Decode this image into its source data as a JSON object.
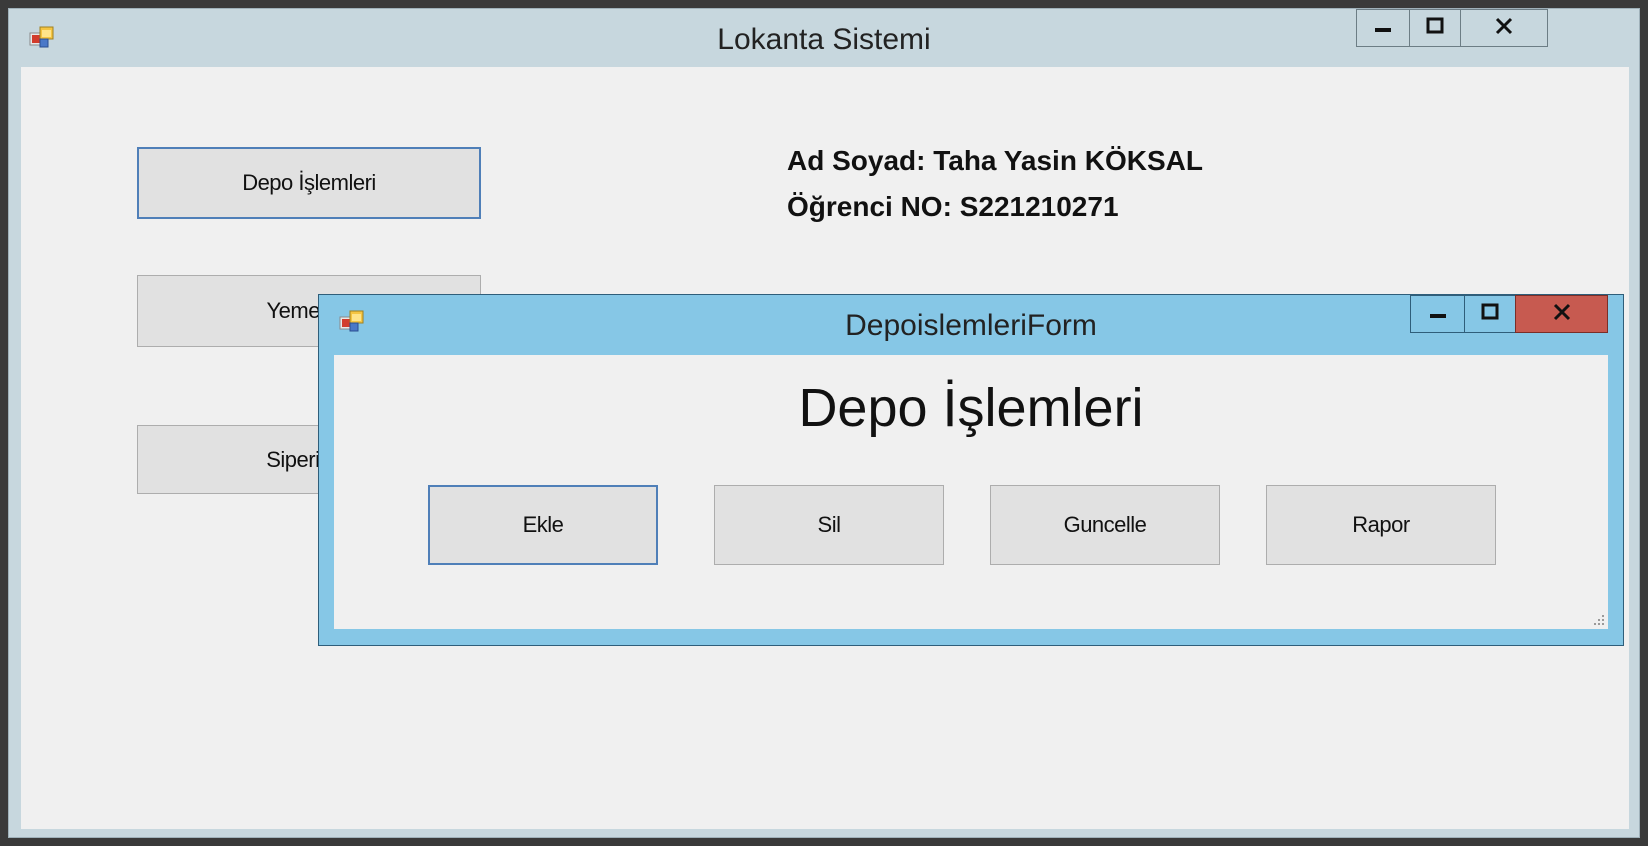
{
  "main_window": {
    "title": "Lokanta Sistemi",
    "icon": "app-form-icon",
    "controls": {
      "minimize": "minimize-icon",
      "maximize": "maximize-icon",
      "close": "close-icon"
    },
    "buttons": [
      {
        "label": "Depo İşlemleri"
      },
      {
        "label": "Yemek Ç"
      },
      {
        "label": "Siperiş İş"
      }
    ],
    "info": {
      "name_line": "Ad Soyad: Taha Yasin KÖKSAL",
      "number_line": "Öğrenci NO: S221210271"
    }
  },
  "child_window": {
    "title": "DepoislemleriForm",
    "icon": "app-form-icon",
    "heading": "Depo İşlemleri",
    "buttons": [
      {
        "label": "Ekle"
      },
      {
        "label": "Sil"
      },
      {
        "label": "Guncelle"
      },
      {
        "label": "Rapor"
      }
    ],
    "close_color": "#c75a50",
    "accent_color": "#86c7e6"
  }
}
